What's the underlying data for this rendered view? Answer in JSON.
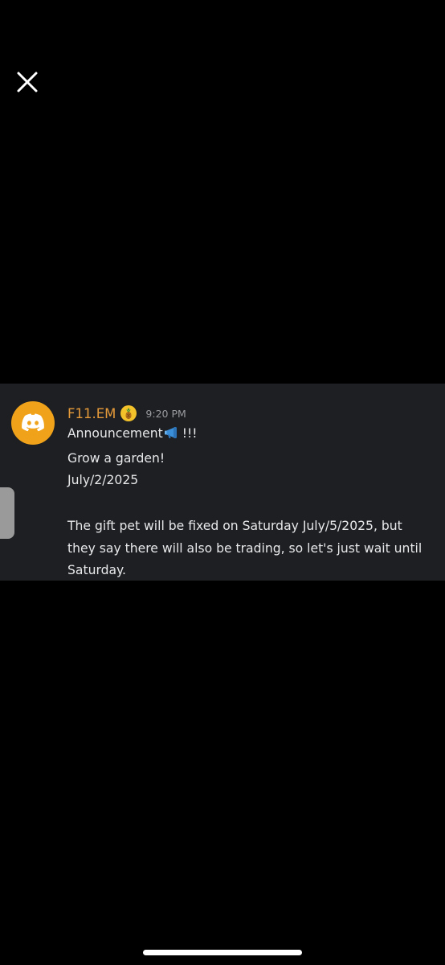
{
  "message": {
    "author": "F11.EM",
    "role_badge_icon": "pineapple-icon",
    "time": "9:20 PM",
    "avatar_icon": "discord-logo-icon",
    "avatar_color": "#f0a31a",
    "author_color": "#e59a3a",
    "lines": {
      "announcement": "Announcement",
      "announcement_emoji": "megaphone-icon",
      "announcement_suffix": "!!!",
      "grow": "Grow a garden!",
      "date": "July/2/2025",
      "paragraph": "The gift pet will be fixed on Saturday July/5/2025, but they say there will also be trading, so let's just wait until Saturday."
    }
  },
  "colors": {
    "background": "#000000",
    "card": "#1e1f22",
    "text": "#e7e8ea",
    "timestamp": "#9a9ba0"
  }
}
